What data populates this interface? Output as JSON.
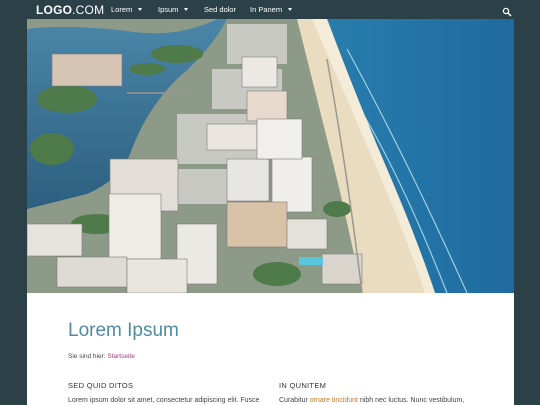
{
  "header": {
    "logo_bold": "LOGO",
    "logo_rest": ".COM",
    "nav": [
      {
        "label": "Lorem",
        "dropdown": true
      },
      {
        "label": "Ipsum",
        "dropdown": true
      },
      {
        "label": "Sed dolor",
        "dropdown": false
      },
      {
        "label": "In Panem",
        "dropdown": true
      }
    ],
    "search_icon": "search-icon"
  },
  "hero": {
    "subject": "aerial-coastal-city-photo"
  },
  "main": {
    "title": "Lorem Ipsum",
    "breadcrumb_prefix": "Sie sind hier:",
    "breadcrumb_link": "Startseite",
    "col1": {
      "heading": "SED QUID DITOS",
      "text": "Lorem ipsum dolor sit amet, consectetur adipiscing elit. Fusce"
    },
    "col2": {
      "heading": "IN QUNITEM",
      "text_before": "Curabitur",
      "text_link": "ornare tincidunt",
      "text_after": "nibh nec luctus. Nunc vestibulum,"
    }
  },
  "colors": {
    "frame": "#2c4048",
    "title": "#4f8ca4",
    "link_purple": "#9b3a7c",
    "link_orange": "#c0792a"
  }
}
